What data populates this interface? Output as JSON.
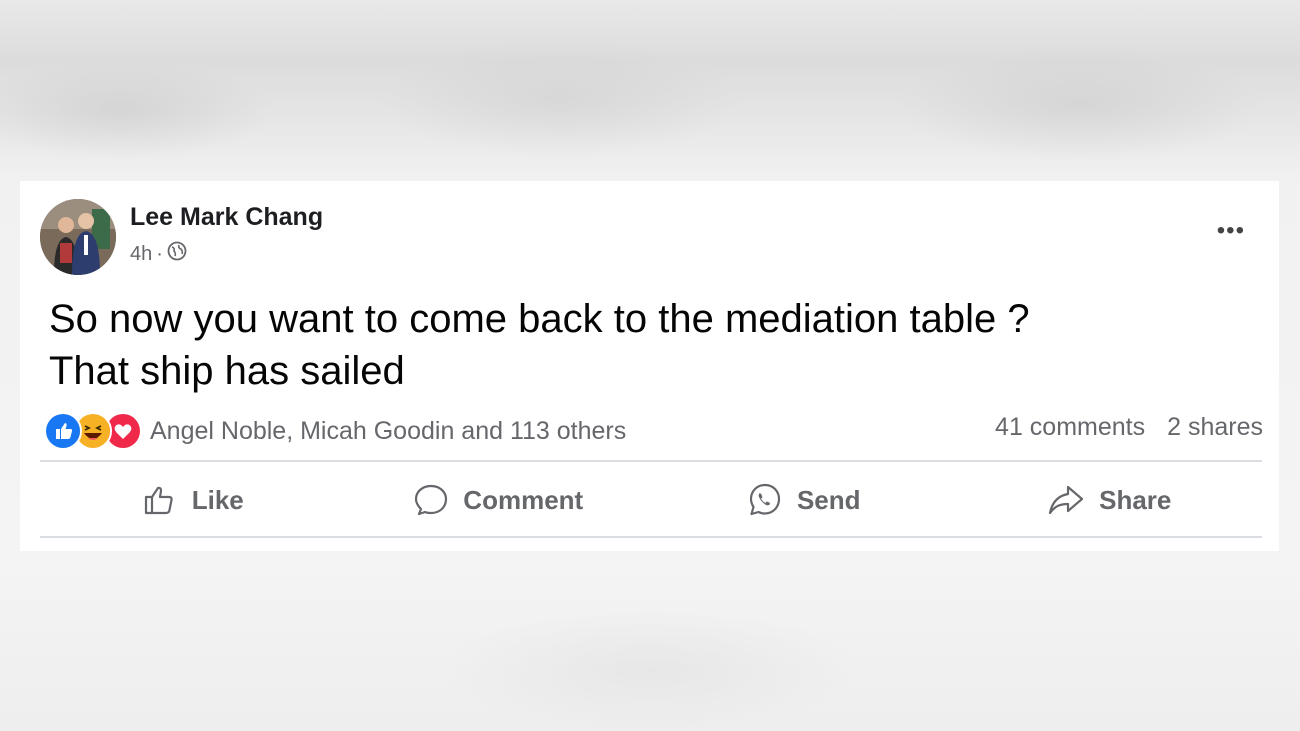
{
  "post": {
    "author": "Lee Mark Chang",
    "time": "4h",
    "separator": "·",
    "visibility_icon": "globe-icon",
    "more_label": "•••",
    "text_line1": "So now you want to come back to the mediation table ?",
    "text_line2": "That ship has sailed"
  },
  "reactions": {
    "icons": [
      "like-reaction-icon",
      "haha-reaction-icon",
      "love-reaction-icon"
    ],
    "names": "Angel Noble, Micah Goodin and 113 others",
    "comments": "41 comments",
    "shares": "2 shares"
  },
  "actions": {
    "like": "Like",
    "comment": "Comment",
    "send": "Send",
    "share": "Share"
  },
  "colors": {
    "like_blue": "#1877f2",
    "love_red": "#f0284a",
    "haha_yellow": "#f7b125",
    "muted_text": "#65676b"
  }
}
